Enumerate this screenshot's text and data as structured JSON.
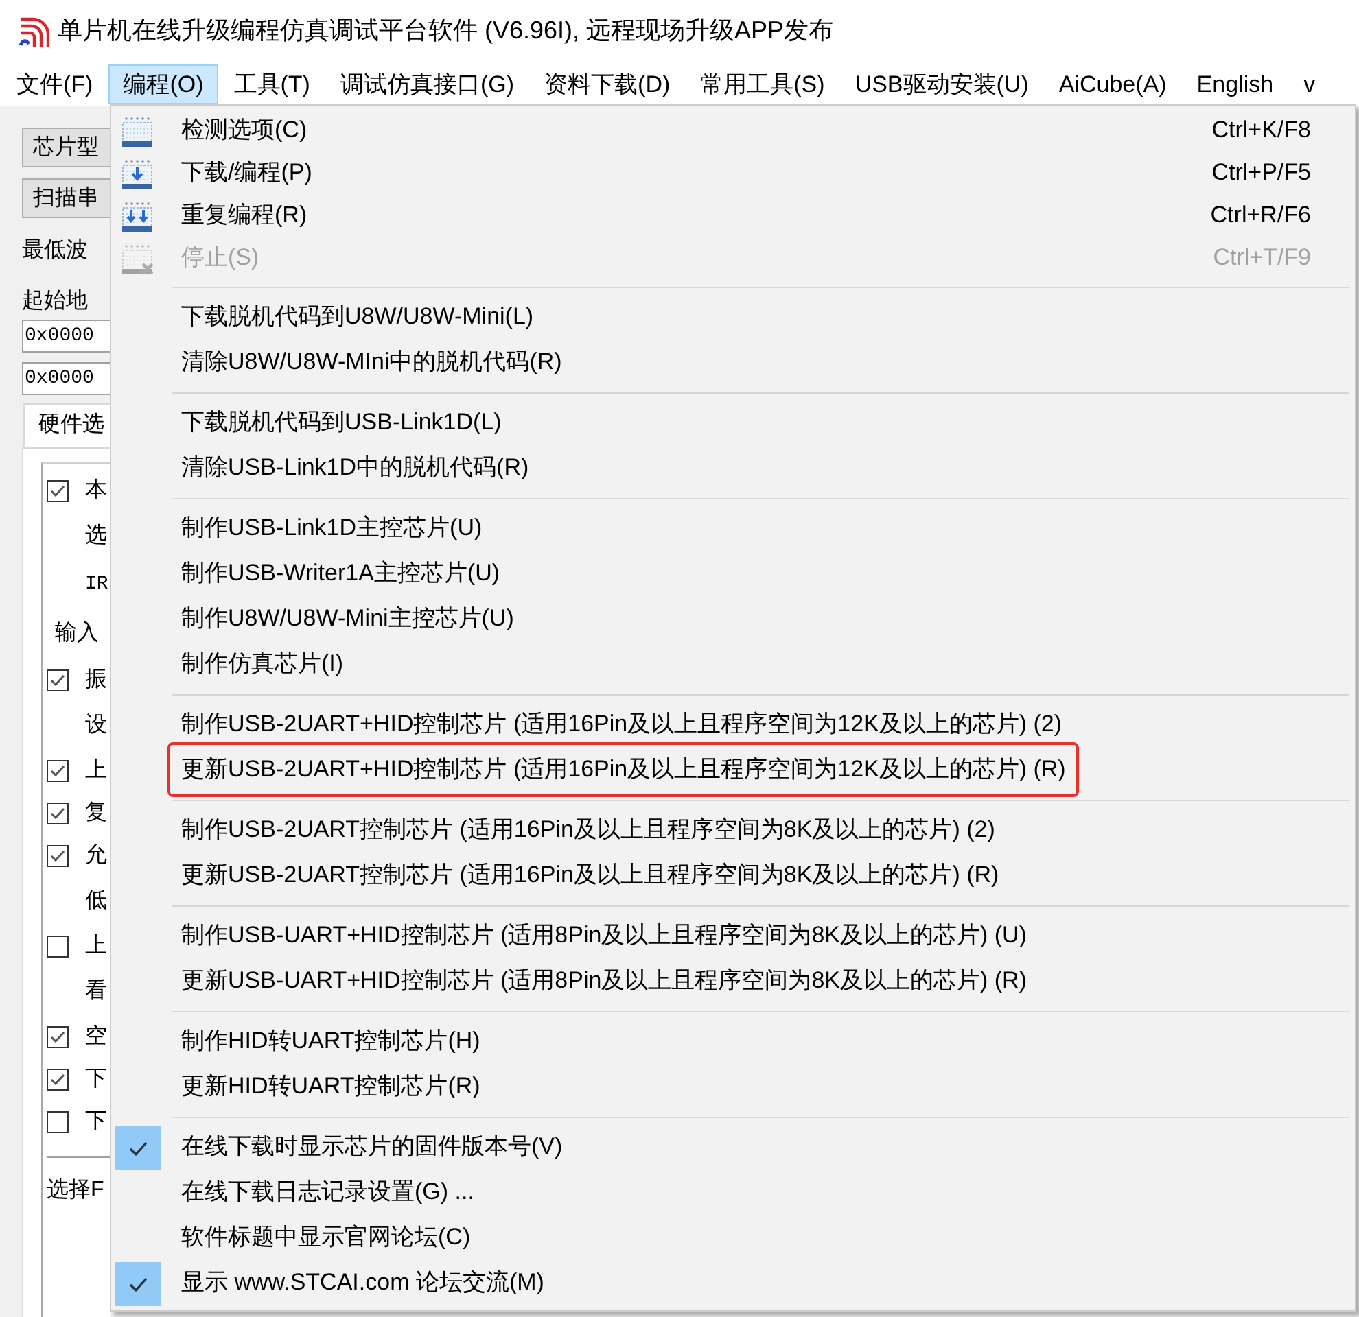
{
  "window": {
    "title": "单片机在线升级编程仿真调试平台软件 (V6.96I), 远程现场升级APP发布"
  },
  "menubar": [
    {
      "label": "文件(F)",
      "selected": false
    },
    {
      "label": "编程(O)",
      "selected": true
    },
    {
      "label": "工具(T)",
      "selected": false
    },
    {
      "label": "调试仿真接口(G)",
      "selected": false
    },
    {
      "label": "资料下载(D)",
      "selected": false
    },
    {
      "label": "常用工具(S)",
      "selected": false
    },
    {
      "label": "USB驱动安装(U)",
      "selected": false
    },
    {
      "label": "AiCube(A)",
      "selected": false
    },
    {
      "label": "English",
      "selected": false
    },
    {
      "label": "v",
      "selected": false
    }
  ],
  "left_panel": {
    "buttons": [
      "芯片型",
      "扫描串"
    ],
    "baud_label": "最低波",
    "address_label": "起始地",
    "address_fields": [
      "0x0000",
      "0x0000"
    ],
    "tabs": [
      {
        "label": "硬件选",
        "selected": true
      }
    ],
    "options": [
      {
        "kind": "checkbox",
        "label": "本",
        "checked": true
      },
      {
        "kind": "note",
        "label": "选"
      },
      {
        "kind": "code",
        "label": "IR"
      },
      {
        "kind": "label",
        "label": "输入"
      },
      {
        "kind": "checkbox",
        "label": "振",
        "checked": true
      },
      {
        "kind": "note",
        "label": "设"
      },
      {
        "kind": "checkbox",
        "label": "上",
        "checked": true
      },
      {
        "kind": "checkbox",
        "label": "复",
        "checked": true
      },
      {
        "kind": "checkbox",
        "label": "允",
        "checked": true
      },
      {
        "kind": "note",
        "label": "低"
      },
      {
        "kind": "checkbox",
        "label": "上",
        "checked": false
      },
      {
        "kind": "note",
        "label": "看"
      },
      {
        "kind": "checkbox",
        "label": "空",
        "checked": true
      },
      {
        "kind": "checkbox",
        "label": "下",
        "checked": true
      },
      {
        "kind": "checkbox",
        "label": "下",
        "checked": false
      }
    ],
    "footer_label": "选择F"
  },
  "menu": {
    "items": [
      {
        "kind": "tool",
        "label": "检测选项(C)",
        "shortcut": "Ctrl+K/F8",
        "disabled": false,
        "checked": false,
        "highlighted": false
      },
      {
        "kind": "tool",
        "label": "下载/编程(P)",
        "shortcut": "Ctrl+P/F5",
        "disabled": false,
        "checked": false,
        "highlighted": false
      },
      {
        "kind": "tool",
        "label": "重复编程(R)",
        "shortcut": "Ctrl+R/F6",
        "disabled": false,
        "checked": false,
        "highlighted": false
      },
      {
        "kind": "tool",
        "label": "停止(S)",
        "shortcut": "Ctrl+T/F9",
        "disabled": true,
        "checked": false,
        "highlighted": false
      },
      {
        "kind": "separator"
      },
      {
        "kind": "command",
        "label": "下载脱机代码到U8W/U8W-Mini(L)",
        "disabled": false,
        "checked": false,
        "highlighted": false
      },
      {
        "kind": "command",
        "label": "清除U8W/U8W-MIni中的脱机代码(R)",
        "disabled": false,
        "checked": false,
        "highlighted": false
      },
      {
        "kind": "separator"
      },
      {
        "kind": "command",
        "label": "下载脱机代码到USB-Link1D(L)",
        "disabled": false,
        "checked": false,
        "highlighted": false
      },
      {
        "kind": "command",
        "label": "清除USB-Link1D中的脱机代码(R)",
        "disabled": false,
        "checked": false,
        "highlighted": false
      },
      {
        "kind": "separator"
      },
      {
        "kind": "command",
        "label": "制作USB-Link1D主控芯片(U)",
        "disabled": false,
        "checked": false,
        "highlighted": false
      },
      {
        "kind": "command",
        "label": "制作USB-Writer1A主控芯片(U)",
        "disabled": false,
        "checked": false,
        "highlighted": false
      },
      {
        "kind": "command",
        "label": "制作U8W/U8W-Mini主控芯片(U)",
        "disabled": false,
        "checked": false,
        "highlighted": false
      },
      {
        "kind": "command",
        "label": "制作仿真芯片(I)",
        "disabled": false,
        "checked": false,
        "highlighted": false
      },
      {
        "kind": "separator"
      },
      {
        "kind": "command",
        "label": "制作USB-2UART+HID控制芯片 (适用16Pin及以上且程序空间为12K及以上的芯片) (2)",
        "disabled": false,
        "checked": false,
        "highlighted": false
      },
      {
        "kind": "command",
        "label": "更新USB-2UART+HID控制芯片 (适用16Pin及以上且程序空间为12K及以上的芯片) (R)",
        "disabled": false,
        "checked": false,
        "highlighted": true
      },
      {
        "kind": "separator"
      },
      {
        "kind": "command",
        "label": "制作USB-2UART控制芯片 (适用16Pin及以上且程序空间为8K及以上的芯片) (2)",
        "disabled": false,
        "checked": false,
        "highlighted": false
      },
      {
        "kind": "command",
        "label": "更新USB-2UART控制芯片 (适用16Pin及以上且程序空间为8K及以上的芯片) (R)",
        "disabled": false,
        "checked": false,
        "highlighted": false
      },
      {
        "kind": "separator"
      },
      {
        "kind": "command",
        "label": "制作USB-UART+HID控制芯片 (适用8Pin及以上且程序空间为8K及以上的芯片) (U)",
        "disabled": false,
        "checked": false,
        "highlighted": false
      },
      {
        "kind": "command",
        "label": "更新USB-UART+HID控制芯片 (适用8Pin及以上且程序空间为8K及以上的芯片) (R)",
        "disabled": false,
        "checked": false,
        "highlighted": false
      },
      {
        "kind": "separator"
      },
      {
        "kind": "command",
        "label": "制作HID转UART控制芯片(H)",
        "disabled": false,
        "checked": false,
        "highlighted": false
      },
      {
        "kind": "command",
        "label": "更新HID转UART控制芯片(R)",
        "disabled": false,
        "checked": false,
        "highlighted": false
      },
      {
        "kind": "separator"
      },
      {
        "kind": "command",
        "label": "在线下载时显示芯片的固件版本号(V)",
        "disabled": false,
        "checked": true,
        "highlighted": false
      },
      {
        "kind": "command",
        "label": "在线下载日志记录设置(G) ...",
        "disabled": false,
        "checked": false,
        "highlighted": false
      },
      {
        "kind": "command",
        "label": "软件标题中显示官网论坛(C)",
        "disabled": false,
        "checked": false,
        "highlighted": false
      },
      {
        "kind": "command",
        "label": "显示 www.STCAI.com 论坛交流(M)",
        "disabled": false,
        "checked": true,
        "highlighted": false
      }
    ]
  }
}
